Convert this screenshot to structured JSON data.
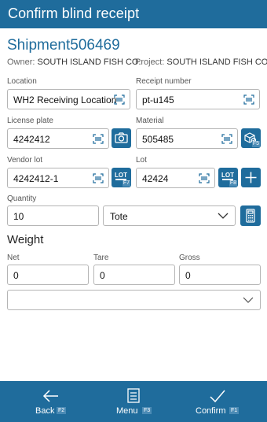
{
  "header": {
    "title": "Confirm blind receipt"
  },
  "shipment": {
    "id": "Shipment506469",
    "owner_label": "Owner:",
    "owner_value": "SOUTH ISLAND FISH CO.",
    "project_label": "Project:",
    "project_value": "SOUTH ISLAND FISH CO"
  },
  "fields": {
    "location": {
      "label": "Location",
      "value": "WH2 Receiving Location"
    },
    "receipt_number": {
      "label": "Receipt number",
      "value": "pt-u145"
    },
    "license_plate": {
      "label": "License plate",
      "value": "4242412"
    },
    "material": {
      "label": "Material",
      "value": "505485",
      "fkey": "F5"
    },
    "vendor_lot": {
      "label": "Vendor lot",
      "value": "4242412-1",
      "fkey": "F7"
    },
    "lot": {
      "label": "Lot",
      "value": "42424",
      "fkey": "F8"
    },
    "quantity": {
      "label": "Quantity",
      "value": "10",
      "uom": "Tote"
    }
  },
  "weight": {
    "title": "Weight",
    "net": {
      "label": "Net",
      "value": "0"
    },
    "tare": {
      "label": "Tare",
      "value": "0"
    },
    "gross": {
      "label": "Gross",
      "value": "0"
    },
    "unit_select": ""
  },
  "lot_icon_text": "LOT",
  "footer": {
    "back": {
      "label": "Back",
      "fkey": "F2"
    },
    "menu": {
      "label": "Menu",
      "fkey": "F3"
    },
    "confirm": {
      "label": "Confirm",
      "fkey": "F1"
    }
  },
  "colors": {
    "primary": "#1f6c9c",
    "fkey_badge": "#4b8bb5"
  },
  "icons": [
    "barcode-scan-icon",
    "camera-icon",
    "box-search-icon",
    "lot-icon",
    "plus-icon",
    "calculator-icon",
    "chevron-down-icon",
    "arrow-left-icon",
    "menu-list-icon",
    "checkmark-icon"
  ]
}
